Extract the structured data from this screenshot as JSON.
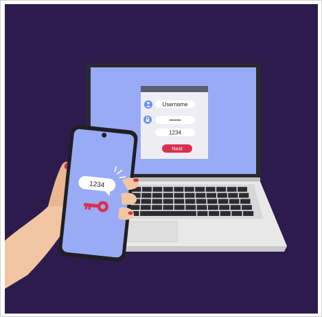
{
  "login_form": {
    "username_placeholder": "Username",
    "password_mask": "••••••••",
    "code_value": "1234",
    "next_button_label": "Next"
  },
  "phone": {
    "message_code": "1234"
  },
  "colors": {
    "background": "#2e1b4d",
    "screen_blue": "#9aabf5",
    "accent_red": "#d9304e",
    "laptop_body": "#e8e8e8",
    "skin": "#f3c6a3"
  },
  "icons": [
    "user-icon",
    "lock-icon",
    "key-icon",
    "notification-sparkle-icon"
  ]
}
